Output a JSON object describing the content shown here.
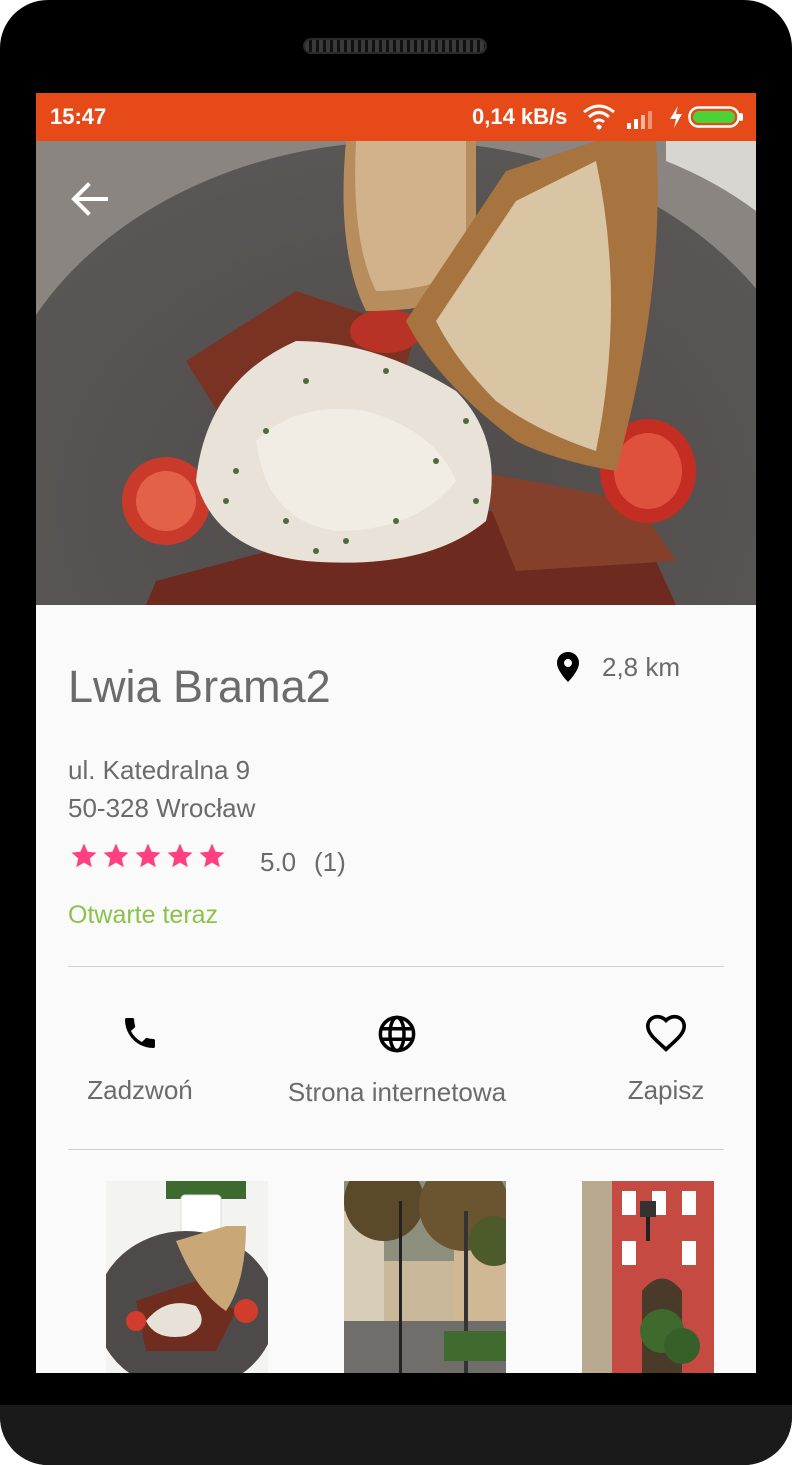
{
  "status_bar": {
    "time": "15:47",
    "network_speed": "0,14 kB/s",
    "icons": [
      "wifi-icon",
      "signal-icon",
      "charging-bolt-icon",
      "battery-icon"
    ],
    "color": "#e64a19",
    "battery_color": "#4cd137"
  },
  "hero_image": {
    "icon": "back-arrow-icon",
    "description_icon": "food-photo"
  },
  "place": {
    "name": "Lwia Brama2",
    "distance": "2,8 km",
    "address_line1": "ul. Katedralna 9",
    "address_line2": "50-328 Wrocław",
    "rating": "5.0",
    "rating_count": "(1)",
    "stars": 5,
    "open_status": "Otwarte teraz"
  },
  "actions": [
    {
      "label": "Zadzwoń",
      "icon": "phone-icon"
    },
    {
      "label": "Strona internetowa",
      "icon": "globe-icon"
    },
    {
      "label": "Zapisz",
      "icon": "heart-outline-icon"
    }
  ],
  "gallery": [
    "food-plate-photo",
    "courtyard-trees-photo",
    "red-building-facade-photo"
  ],
  "colors": {
    "accent": "#e64a19",
    "star": "#ff4081",
    "open": "#8bc34a",
    "text": "#6b6b6b"
  }
}
